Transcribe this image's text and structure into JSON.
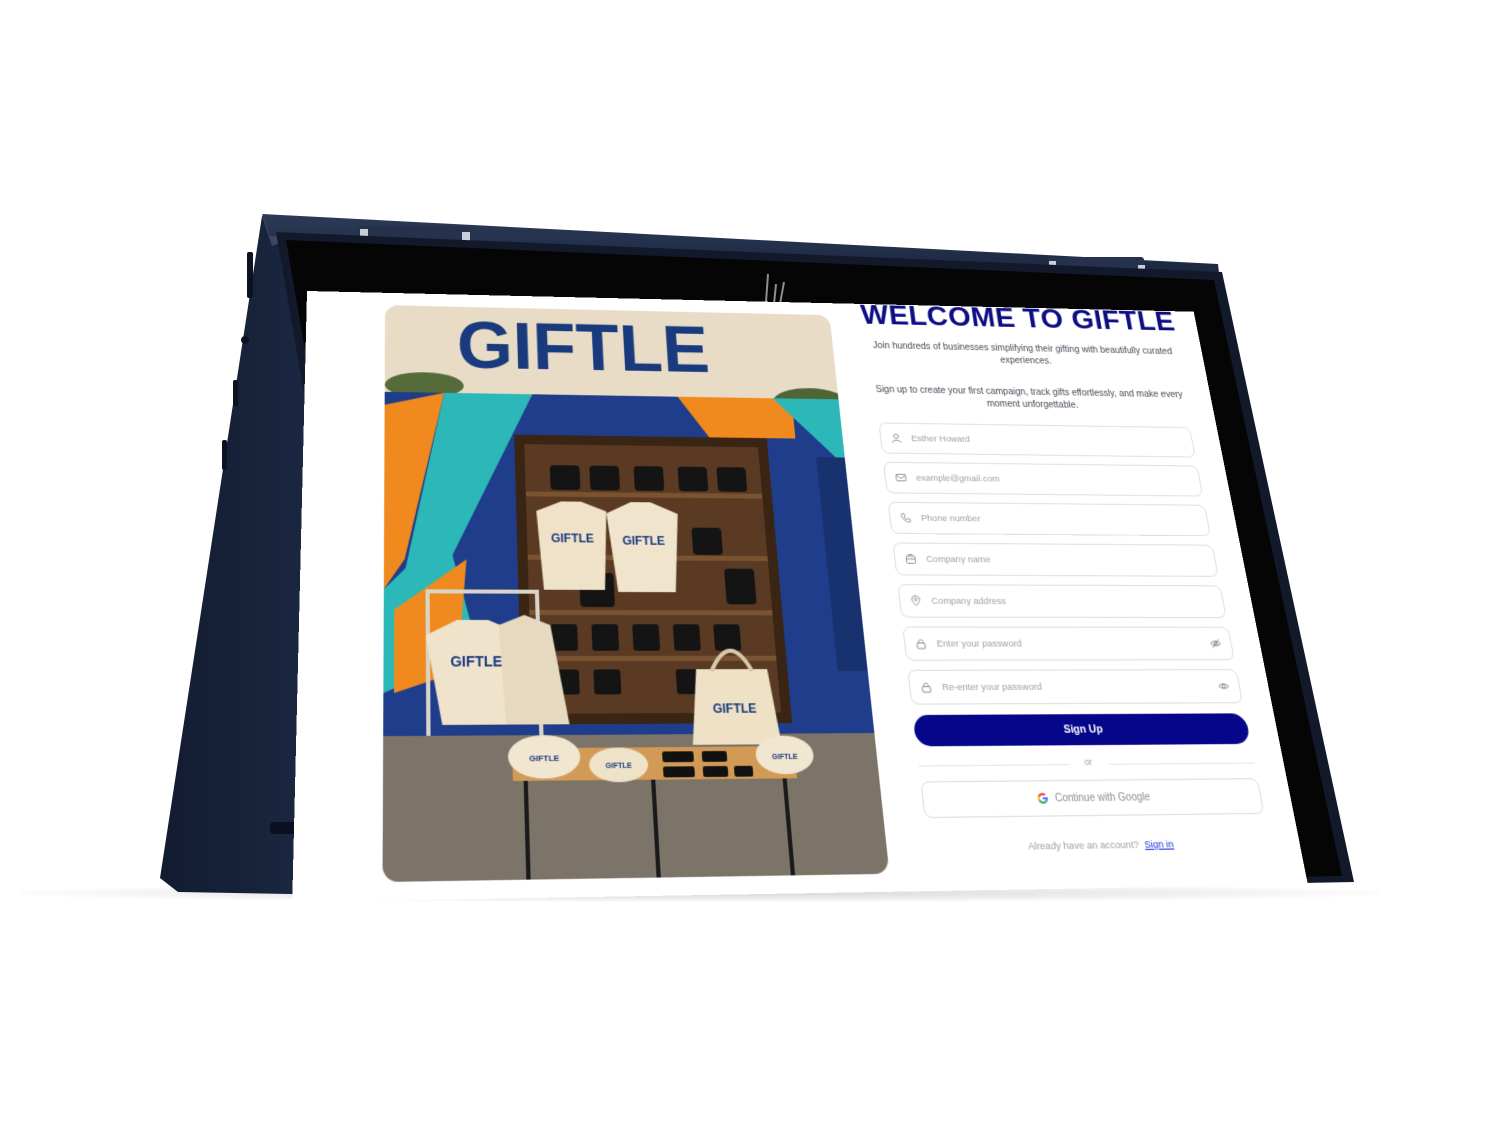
{
  "app": {
    "brand": "GIFTLE",
    "device_logo": "hp-logo-icon"
  },
  "promo": {
    "headline": "GIFTLE",
    "product_print": "GIFTLE"
  },
  "signup": {
    "title": "WELCOME TO GIFTLE",
    "intro": "Join hundreds of businesses simplifying their gifting with beautifully curated experiences.",
    "cta": "Sign up to create your first campaign, track gifts effortlessly, and make every moment unforgettable.",
    "fields": {
      "name": {
        "placeholder": "Esther Howard",
        "icon": "user-icon"
      },
      "email": {
        "placeholder": "example@gmail.com",
        "icon": "mail-icon"
      },
      "phone": {
        "placeholder": "Phone number",
        "icon": "phone-icon"
      },
      "company": {
        "placeholder": "Company name",
        "icon": "building-icon"
      },
      "address": {
        "placeholder": "Company address",
        "icon": "location-pin-icon"
      },
      "password": {
        "placeholder": "Enter your password",
        "icon": "lock-icon",
        "toggle": "eye-off-icon"
      },
      "confirm": {
        "placeholder": "Re-enter your password",
        "icon": "lock-icon",
        "toggle": "eye-icon"
      }
    },
    "submit_label": "Sign Up",
    "divider": "or",
    "google_label": "Continue with Google",
    "signin_prompt": "Already have an account?",
    "signin_link": "Sign in"
  },
  "colors": {
    "accent": "#06068a",
    "title": "#0d0d84",
    "link": "#1a2ee0",
    "device": "#1d2a44"
  }
}
